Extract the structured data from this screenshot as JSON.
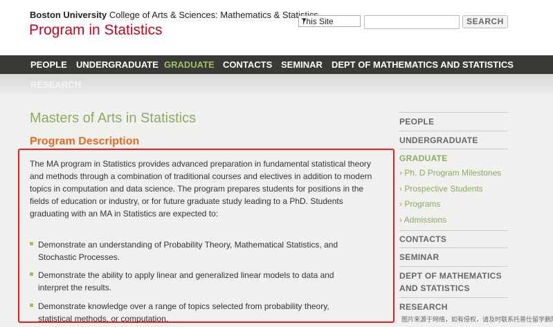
{
  "header": {
    "university": "Boston University",
    "college": "College of Arts & Sciences: Mathematics & Statistics",
    "program_title": "Program in Statistics",
    "scope_select": "This Site",
    "search_value": "",
    "search_button": "SEARCH"
  },
  "nav": {
    "items": [
      "PEOPLE",
      "UNDERGRADUATE",
      "GRADUATE",
      "CONTACTS",
      "SEMINAR",
      "DEPT OF MATHEMATICS AND STATISTICS",
      "RESEARCH"
    ],
    "active": "GRADUATE"
  },
  "main": {
    "title": "Masters of Arts in Statistics",
    "section_heading": "Program Description",
    "intro": "The MA program in Statistics provides advanced preparation in fundamental statistical theory and methods through a combination of traditional courses and electives in addition to modern topics in computation and data science. The program prepares students for positions in the fields of education or industry, or for future graduate study leading to a PhD. Students graduating with an MA in Statistics are expected to:",
    "outcomes": [
      "Demonstrate an understanding of Probability Theory, Mathematical Statistics, and Stochastic Processes.",
      "Demonstrate the ability to apply linear and generalized linear models to data and interpret the results.",
      "Demonstrate knowledge over a range of topics selected from probability theory, statistical methods, or computation."
    ]
  },
  "sidebar": {
    "items": [
      "PEOPLE",
      "UNDERGRADUATE",
      "GRADUATE",
      "CONTACTS",
      "SEMINAR",
      "DEPT OF MATHEMATICS AND STATISTICS",
      "RESEARCH"
    ],
    "graduate_sub": [
      "Ph. D Program Milestones",
      "Prospective Students",
      "Programs",
      "Admissions"
    ]
  },
  "watermark": "图片来源于网络，如有侵权，请及时联系托普仕留学删除"
}
